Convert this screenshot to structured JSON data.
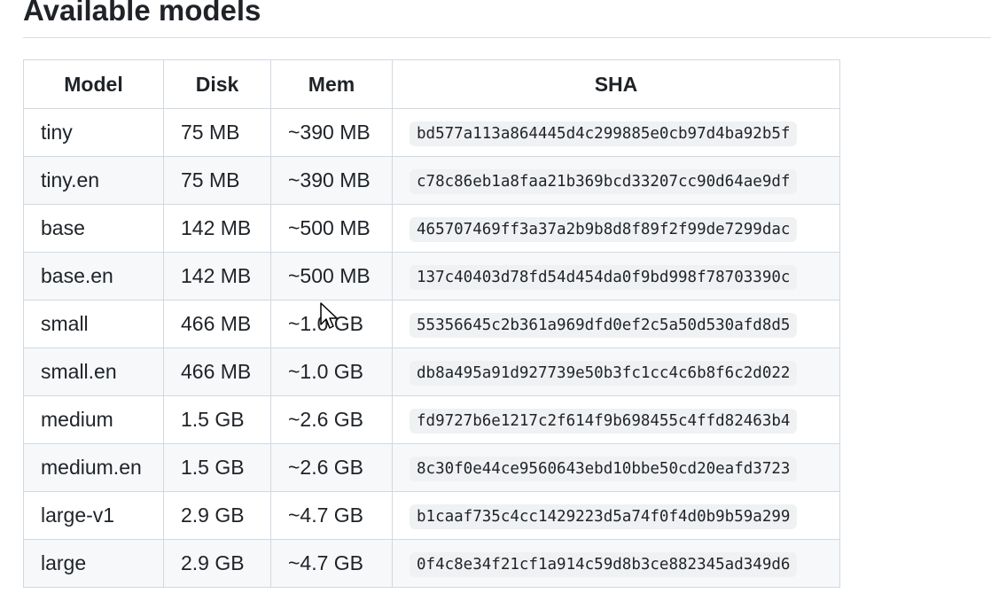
{
  "page": {
    "heading": "Available models"
  },
  "table": {
    "headers": [
      "Model",
      "Disk",
      "Mem",
      "SHA"
    ],
    "rows": [
      {
        "model": "tiny",
        "disk": "75 MB",
        "mem": "~390 MB",
        "sha": "bd577a113a864445d4c299885e0cb97d4ba92b5f"
      },
      {
        "model": "tiny.en",
        "disk": "75 MB",
        "mem": "~390 MB",
        "sha": "c78c86eb1a8faa21b369bcd33207cc90d64ae9df"
      },
      {
        "model": "base",
        "disk": "142 MB",
        "mem": "~500 MB",
        "sha": "465707469ff3a37a2b9b8d8f89f2f99de7299dac"
      },
      {
        "model": "base.en",
        "disk": "142 MB",
        "mem": "~500 MB",
        "sha": "137c40403d78fd54d454da0f9bd998f78703390c"
      },
      {
        "model": "small",
        "disk": "466 MB",
        "mem": "~1.0 GB",
        "sha": "55356645c2b361a969dfd0ef2c5a50d530afd8d5"
      },
      {
        "model": "small.en",
        "disk": "466 MB",
        "mem": "~1.0 GB",
        "sha": "db8a495a91d927739e50b3fc1cc4c6b8f6c2d022"
      },
      {
        "model": "medium",
        "disk": "1.5 GB",
        "mem": "~2.6 GB",
        "sha": "fd9727b6e1217c2f614f9b698455c4ffd82463b4"
      },
      {
        "model": "medium.en",
        "disk": "1.5 GB",
        "mem": "~2.6 GB",
        "sha": "8c30f0e44ce9560643ebd10bbe50cd20eafd3723"
      },
      {
        "model": "large-v1",
        "disk": "2.9 GB",
        "mem": "~4.7 GB",
        "sha": "b1caaf735c4cc1429223d5a74f0f4d0b9b59a299"
      },
      {
        "model": "large",
        "disk": "2.9 GB",
        "mem": "~4.7 GB",
        "sha": "0f4c8e34f21cf1a914c59d8b3ce882345ad349d6"
      }
    ]
  },
  "icons": {
    "cursor": "mouse-pointer-icon"
  }
}
